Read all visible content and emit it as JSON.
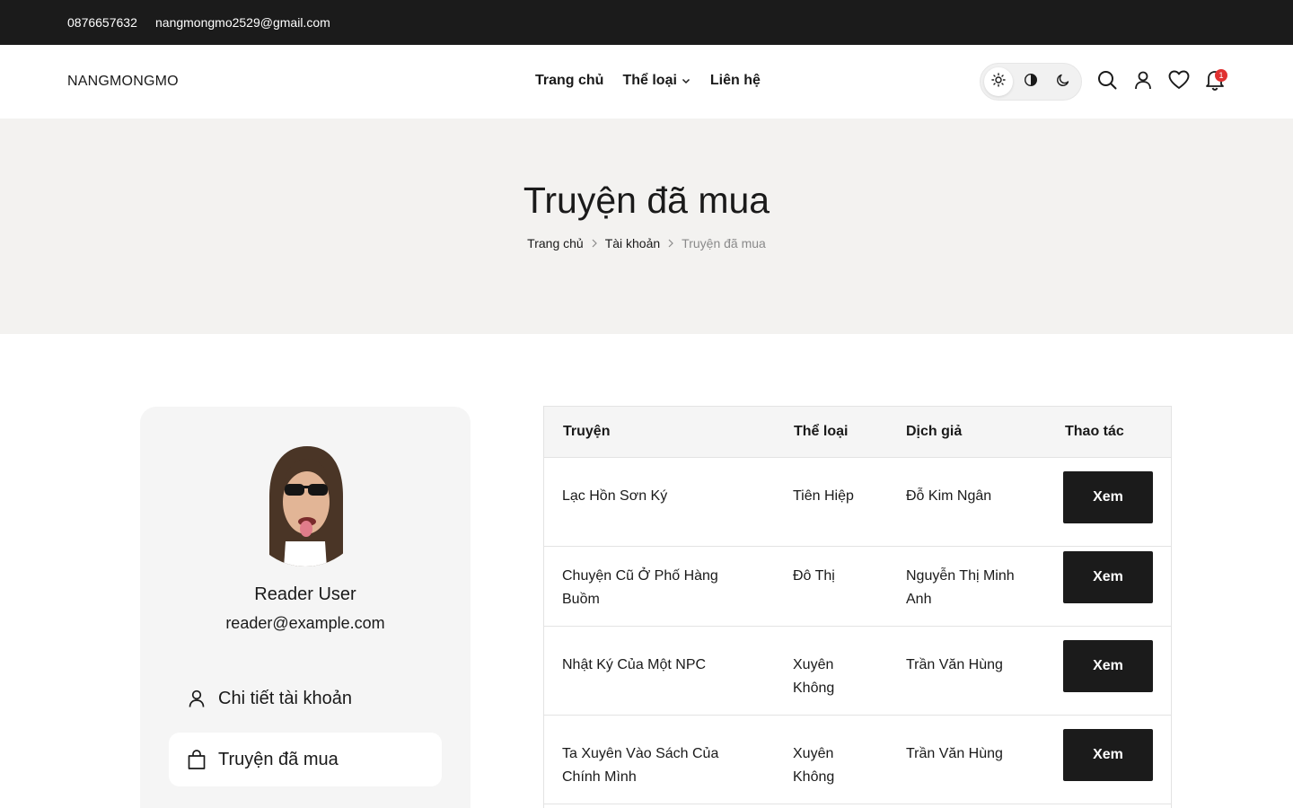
{
  "topbar": {
    "phone": "0876657632",
    "email": "nangmongmo2529@gmail.com"
  },
  "header": {
    "logo": "NANGMONGMO",
    "nav": {
      "home": "Trang chủ",
      "categories": "Thể loại",
      "contact": "Liên hệ"
    },
    "notification_count": "1"
  },
  "hero": {
    "title": "Truyện đã mua",
    "breadcrumb": [
      "Trang chủ",
      "Tài khoản",
      "Truyện đã mua"
    ]
  },
  "sidebar": {
    "user_name": "Reader User",
    "user_email": "reader@example.com",
    "menu": {
      "account": "Chi tiết tài khoản",
      "purchased": "Truyện đã mua"
    }
  },
  "table": {
    "headers": {
      "title": "Truyện",
      "genre": "Thể loại",
      "translator": "Dịch giả",
      "action": "Thao tác"
    },
    "rows": [
      {
        "title": "Lạc Hồn Sơn Ký",
        "genre": "Tiên Hiệp",
        "translator": "Đỗ Kim Ngân",
        "action": "Xem"
      },
      {
        "title": "Chuyện Cũ Ở Phố Hàng Buồm",
        "genre": "Đô Thị",
        "translator": "Nguyễn Thị Minh Anh",
        "action": "Xem"
      },
      {
        "title": "Nhật Ký Của Một NPC",
        "genre": "Xuyên Không",
        "translator": "Trần Văn Hùng",
        "action": "Xem"
      },
      {
        "title": "Ta Xuyên Vào Sách Của Chính Mình",
        "genre": "Xuyên Không",
        "translator": "Trần Văn Hùng",
        "action": "Xem"
      }
    ]
  },
  "colors": {
    "topbar_bg": "#1b1b1b",
    "hero_bg": "#f3f2f0",
    "button_bg": "#1b1b1b",
    "badge": "#e03131"
  }
}
